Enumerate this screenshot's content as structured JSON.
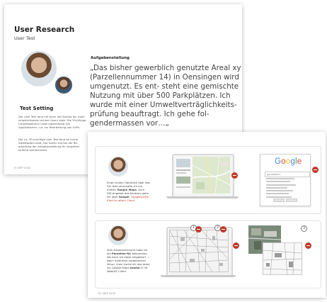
{
  "page1": {
    "title": "User Research",
    "subtitle": "User Test",
    "setting_heading": "Test Setting",
    "setting_text_1": "Der User Test fand mit einer mit Sandra Ko- mem vergleichbarem echten Usern statt. Die 39-jährige Umweltplanerin nutzt regelmässig GIS Applikationen, u.a. zur Bearbeitung von UVPs.",
    "setting_text_2": "Der ca. 30-minütige User Test fand an ihrem Arbeitsplatz statt. Die Userin hat bei der Be- arbeitung der Aufgabenstellung ihr Vorgehen laufend kommentiert.",
    "task_heading": "Aufgabenstellung",
    "quote": "„Das bisher gewerblich genutzte Areal xy (Parzellennummer 14) in Oensingen wird umgenutzt. Es ent- steht eine gemischte Nutzung mit über 500 Parkplätzen. Ich wurde mit einer Umweltverträglichkeits- prüfung beauftragt. Ich gehe fol- gendermassen vor…„",
    "footer": "9    I DEP 2018"
  },
  "page2": {
    "card1": {
      "text_1": "Einen ersten Überblick über das Ge- biet verschaffe ich mir mittels",
      "text_bold_1": "Google Maps",
      "text_2": ". Zum GIS-Angebot des Kantons gehe ich über",
      "text_bold_2": "Google",
      "text_3": ".",
      "link": "Googlesuche führt zu altem Client",
      "google_logo": [
        "G",
        "o",
        "o",
        "g",
        "l",
        "e"
      ],
      "google_colors": [
        "#4285F4",
        "#EA4335",
        "#FBBC05",
        "#4285F4",
        "#34A853",
        "#EA4335"
      ],
      "search_query": "gis solothurn"
    },
    "card2": {
      "text_1": "Vom Entwicklermenü habe ich die",
      "text_bold_1": "Parzellen-Nr.",
      "text_2": "bekommen. Wo kann ich diese eingeben? …",
      "text_3": "Nach mehreren vergeblichen Versu- chen suche ich das Areal via Google Maps",
      "text_bold_2": "zoome",
      "text_4": "in im WebGIS Client.",
      "steps": [
        "1",
        "2",
        "3"
      ]
    },
    "footer": "10    I DEP 2018"
  },
  "colors": {
    "accent_red": "#c0392b",
    "map_green": "#dde8cf"
  }
}
